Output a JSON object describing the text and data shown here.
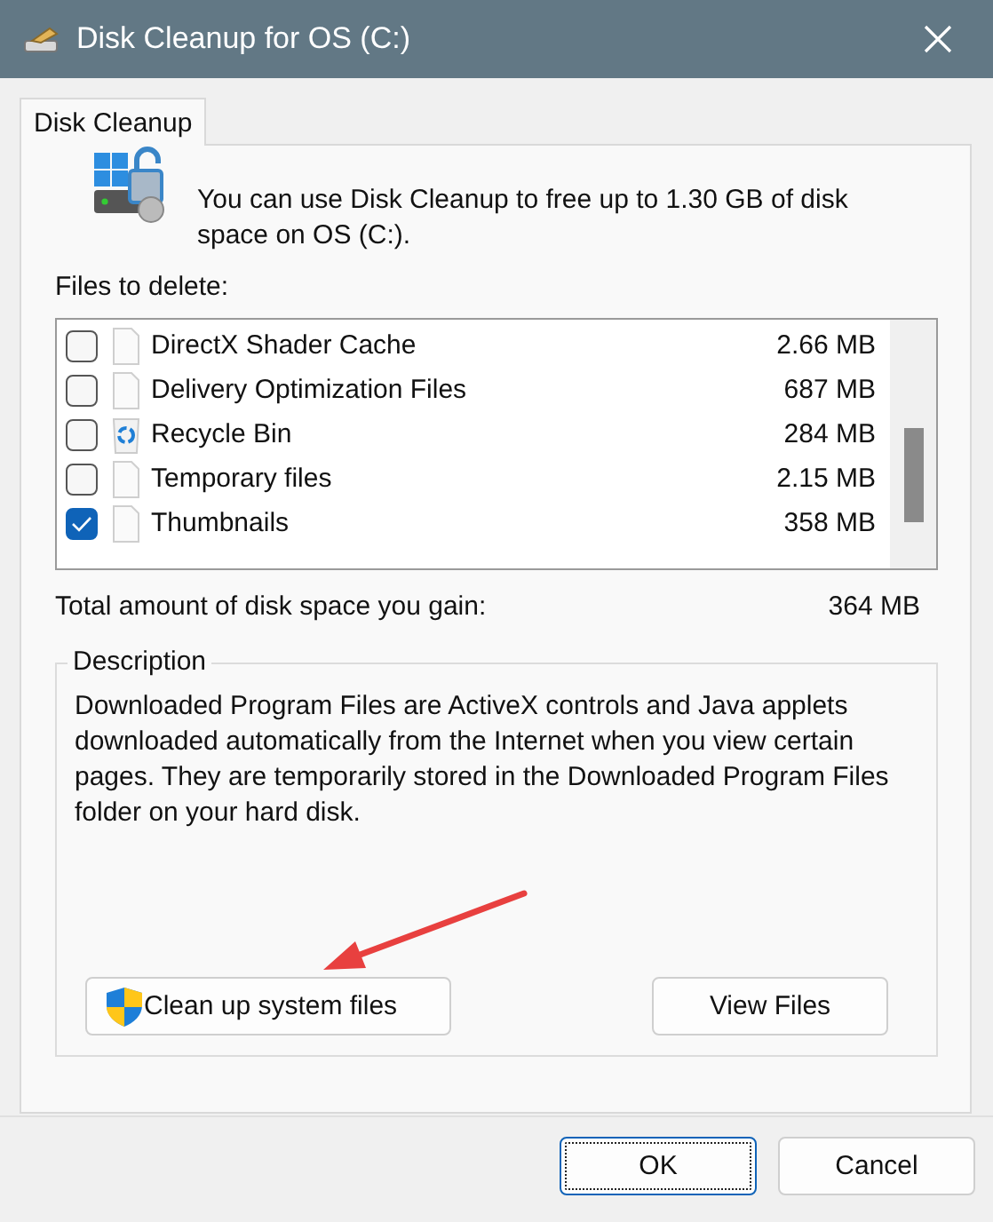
{
  "window": {
    "title": "Disk Cleanup for OS (C:)"
  },
  "tabs": [
    {
      "label": "Disk Cleanup",
      "selected": true
    }
  ],
  "intro": "You can use Disk Cleanup to free up to 1.30 GB of disk space on OS (C:).",
  "files_label": "Files to delete:",
  "files": [
    {
      "name": "DirectX Shader Cache",
      "size": "2.66 MB",
      "checked": false,
      "kind": "file"
    },
    {
      "name": "Delivery Optimization Files",
      "size": "687 MB",
      "checked": false,
      "kind": "file"
    },
    {
      "name": "Recycle Bin",
      "size": "284 MB",
      "checked": false,
      "kind": "recycle"
    },
    {
      "name": "Temporary files",
      "size": "2.15 MB",
      "checked": false,
      "kind": "file"
    },
    {
      "name": "Thumbnails",
      "size": "358 MB",
      "checked": true,
      "kind": "file"
    }
  ],
  "total": {
    "label": "Total amount of disk space you gain:",
    "value": "364 MB"
  },
  "description": {
    "title": "Description",
    "text": "Downloaded Program Files are ActiveX controls and Java applets downloaded automatically from the Internet when you view certain pages. They are temporarily stored in the Downloaded Program Files folder on your hard disk."
  },
  "actions": [
    {
      "label": "Clean up system files",
      "kind": "shield"
    },
    {
      "label": "View Files",
      "kind": "plain"
    }
  ],
  "buttons": [
    {
      "label": "OK",
      "kind": "default"
    },
    {
      "label": "Cancel",
      "kind": "normal"
    }
  ]
}
